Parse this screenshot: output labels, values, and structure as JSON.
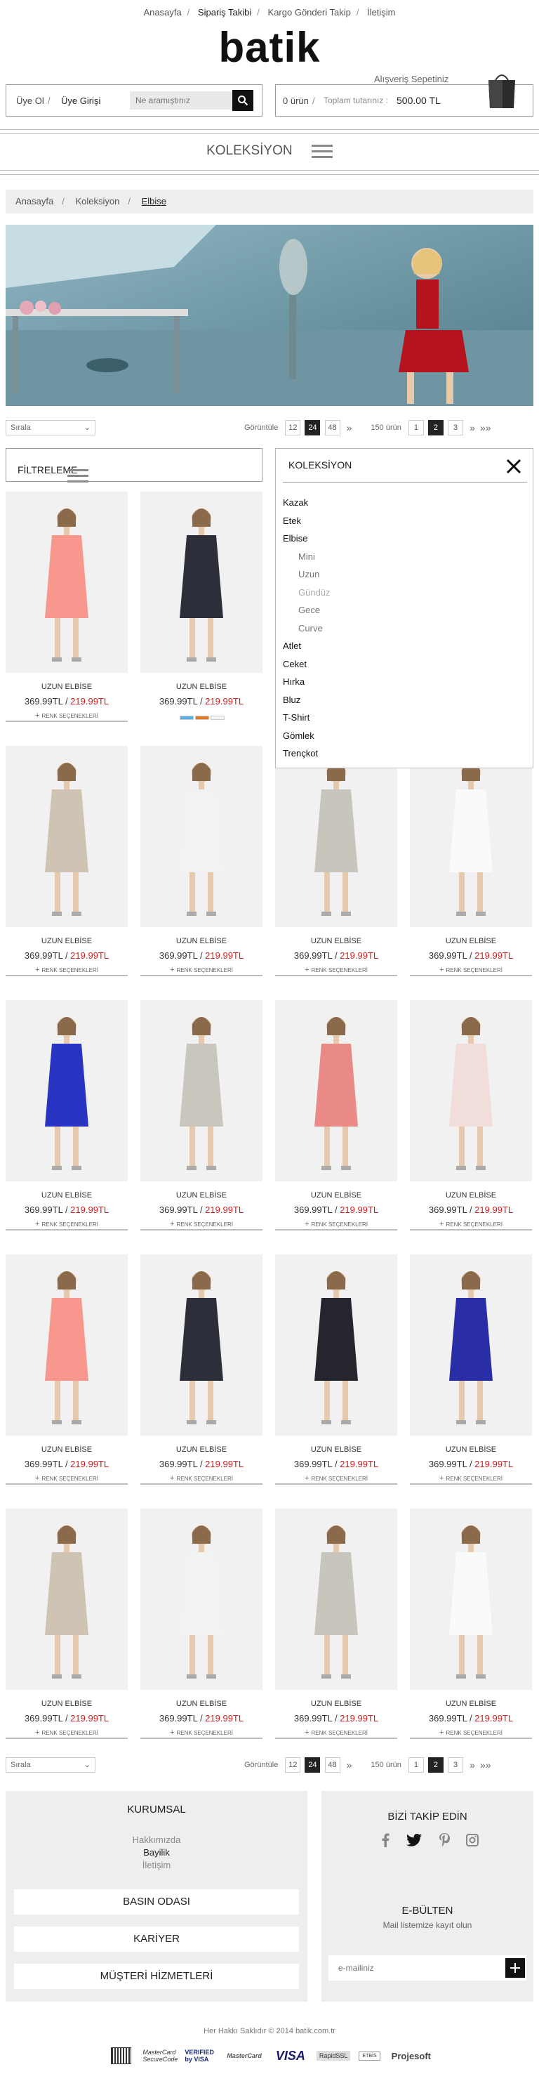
{
  "topnav": {
    "items": [
      "Anasayfa",
      "Sipariş Takibi",
      "Kargo Gönderi Takip",
      "İletişim"
    ]
  },
  "logo": "batik",
  "account": {
    "register": "Üye Ol",
    "login": "Üye Girişi",
    "search_placeholder": "Ne aramıştınız"
  },
  "cart": {
    "title": "Alışveriş Sepetiniz",
    "count": "0 ürün",
    "total_label": "Toplam tutarınız :",
    "total_value": "500.00 TL"
  },
  "collection_title": "KOLEKSİYON",
  "breadcrumb": [
    "Anasayfa",
    "Koleksiyon",
    "Elbise"
  ],
  "sortbar": {
    "sort_label": "Sırala",
    "view_label": "Görüntüle",
    "view_options": [
      "12",
      "24",
      "48"
    ],
    "view_active": "24",
    "count_label": "150 ürün",
    "pages": [
      "1",
      "2",
      "3"
    ],
    "page_active": "2"
  },
  "filter": {
    "title": "FİLTRELEME"
  },
  "koleksiyon_panel": {
    "title": "KOLEKSİYON",
    "items": [
      {
        "label": "Kazak",
        "level": 0
      },
      {
        "label": "Etek",
        "level": 0
      },
      {
        "label": "Elbise",
        "level": 0
      },
      {
        "label": "Mini",
        "level": 1
      },
      {
        "label": "Uzun",
        "level": 1
      },
      {
        "label": "Gündüz",
        "level": 1,
        "dim": true
      },
      {
        "label": "Gece",
        "level": 1
      },
      {
        "label": "Curve",
        "level": 1
      },
      {
        "label": "Atlet",
        "level": 0
      },
      {
        "label": "Ceket",
        "level": 0
      },
      {
        "label": "Hırka",
        "level": 0
      },
      {
        "label": "Bluz",
        "level": 0
      },
      {
        "label": "T-Shirt",
        "level": 0
      },
      {
        "label": "Gömlek",
        "level": 0
      },
      {
        "label": "Trençkot",
        "level": 0
      }
    ]
  },
  "product_defaults": {
    "name": "UZUN ELBİSE",
    "price": "369.99TL",
    "sale": "219.99TL",
    "renk": "RENK SEÇENEKLERİ"
  },
  "products": [
    {
      "color": "#f7978d"
    },
    {
      "color": "#2c2e3a",
      "swatches": [
        "#5aaee0",
        "#e07a22",
        "#f4f4f4"
      ]
    },
    {
      "color": "#cfc4b3"
    },
    {
      "color": "#f2f2f2"
    },
    {
      "color": "#c8c5bd"
    },
    {
      "color": "#fafafa"
    },
    {
      "color": "#2a34c2"
    },
    {
      "color": "#c9c6bd"
    },
    {
      "color": "#ea8a86"
    },
    {
      "color": "#f1dedb"
    },
    {
      "color": "#f7978d"
    },
    {
      "color": "#2c2e3a"
    },
    {
      "color": "#25262d"
    },
    {
      "color": "#2a2ea6"
    },
    {
      "color": "#cfc4b3"
    },
    {
      "color": "#f2f2f2"
    },
    {
      "color": "#c8c5bd"
    },
    {
      "color": "#fafafa"
    }
  ],
  "footer": {
    "kurumsal_title": "KURUMSAL",
    "kurumsal_links": [
      "Hakkımızda",
      "Bayilik",
      "İletişim"
    ],
    "buttons": [
      "BASIN ODASI",
      "KARİYER",
      "MÜŞTERİ HİZMETLERİ"
    ],
    "follow_title": "BİZİ TAKİP EDİN",
    "social_icons": [
      "facebook-icon",
      "twitter-icon",
      "pinterest-icon",
      "instagram-icon"
    ],
    "newsletter_title": "E-BÜLTEN",
    "newsletter_subtitle": "Mail listemize kayıt olun",
    "email_placeholder": "e-mailiniz"
  },
  "copyright": "Her Hakkı Saklıdır © 2014 batik.com.tr",
  "payment_logos": [
    "MasterCard SecureCode",
    "VERIFIED by VISA",
    "MasterCard",
    "VISA",
    "RapidSSL",
    "ETBİS",
    "Projesoft"
  ],
  "colors": {
    "sale": "#d01e1e",
    "dark": "#111111"
  }
}
